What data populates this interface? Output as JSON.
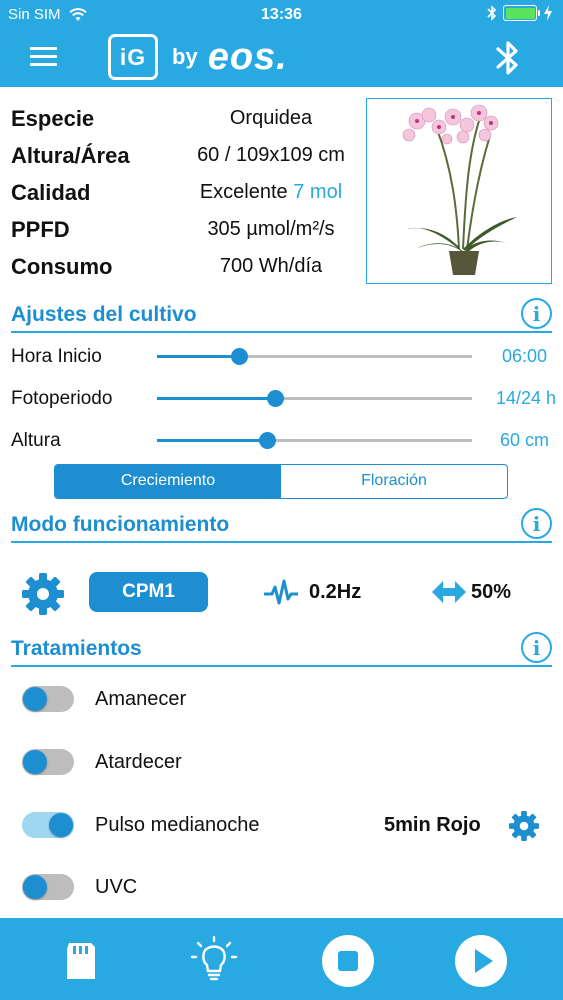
{
  "status_bar": {
    "carrier": "Sin SIM",
    "time": "13:36"
  },
  "nav": {
    "logo_text": "iG",
    "logo_by": "by",
    "logo_brand": "eos."
  },
  "info": {
    "rows": [
      {
        "label": "Especie",
        "value": "Orquidea"
      },
      {
        "label": "Altura/Área",
        "value": "60 / 109x109 cm"
      },
      {
        "label": "Calidad",
        "value": "Excelente",
        "accent": "7 mol"
      },
      {
        "label": "PPFD",
        "value": "305 µmol/m²/s"
      },
      {
        "label": "Consumo",
        "value": "700 Wh/día"
      }
    ]
  },
  "ajustes": {
    "title": "Ajustes del cultivo",
    "sliders": [
      {
        "label": "Hora Inicio",
        "value": "06:00",
        "level": 0.26
      },
      {
        "label": "Fotoperiodo",
        "value": "14/24 h",
        "level": 0.375
      },
      {
        "label": "Altura",
        "value": "60 cm",
        "level": 0.35
      }
    ],
    "segments": [
      "Creciemiento",
      "Floración"
    ],
    "active_segment": "Creciemiento"
  },
  "modo": {
    "title": "Modo funcionamiento",
    "mode_button": "CPM1",
    "frequency": "0.2Hz",
    "duty": "50%"
  },
  "tratamientos": {
    "title": "Tratamientos",
    "items": [
      {
        "label": "Amanecer",
        "on": false
      },
      {
        "label": "Atardecer",
        "on": false
      },
      {
        "label": "Pulso medianoche",
        "on": true,
        "extra": "5min Rojo"
      },
      {
        "label": "UVC",
        "on": false
      }
    ]
  },
  "bottom_bar": {
    "icons": [
      "sd-card-icon",
      "bulb-icon",
      "stop-icon",
      "play-icon"
    ]
  },
  "colors": {
    "primary": "#29A9E1",
    "accent_dark": "#1D8FD0"
  }
}
